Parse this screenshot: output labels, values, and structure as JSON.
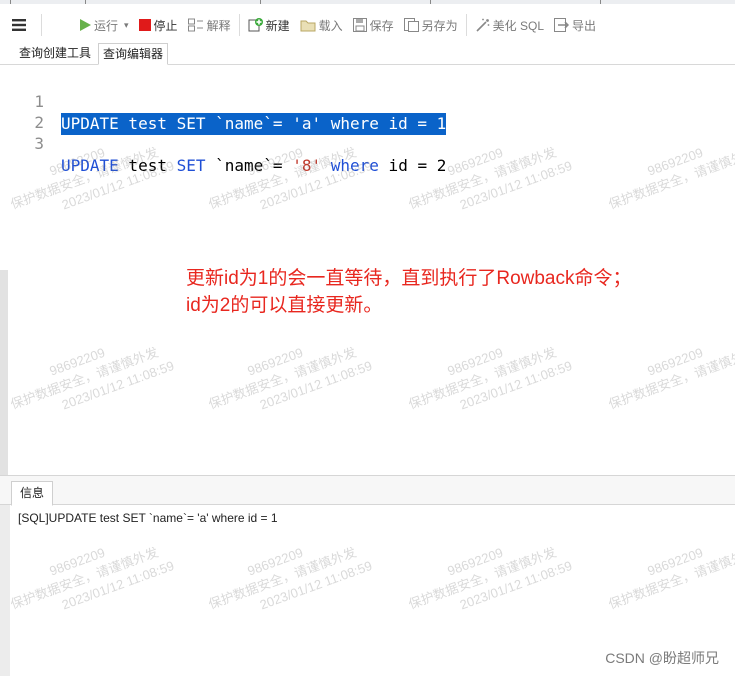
{
  "toolbar": {
    "run_label": "运行",
    "run_dropdown": "▾",
    "stop_label": "停止",
    "explain_label": "解释",
    "new_label": "新建",
    "load_label": "载入",
    "save_label": "保存",
    "saveas_label": "另存为",
    "beautify_label": "美化 SQL",
    "export_label": "导出"
  },
  "subtabs": [
    "查询创建工具",
    "查询编辑器"
  ],
  "editor": {
    "lines": [
      {
        "num": "1",
        "tokens": [
          "UPDATE test SET `name`= 'a' where id = 1"
        ]
      },
      {
        "num": "2",
        "tokens": []
      },
      {
        "num": "3",
        "tokens": [
          "UPDATE",
          " test ",
          "SET",
          " `name`= ",
          "'8'",
          " ",
          "where",
          " id = 2"
        ]
      }
    ]
  },
  "annotation": {
    "line1": "更新id为1的会一直等待，直到执行了Rowback命令；",
    "line2": "id为2的可以直接更新。"
  },
  "panel": {
    "tab_label": "信息",
    "message": "[SQL]UPDATE test SET `name`= 'a' where id = 1"
  },
  "watermark": {
    "line1": "98692209",
    "line2": "保护数据安全，请谨慎外发",
    "line3": "2023/01/12 11:08:59"
  },
  "credit": "CSDN @盼超师兄",
  "colors": {
    "selection": "#0a63c9",
    "keyword": "#1f4fd6",
    "string": "#c0392b",
    "annotation": "#e8271f"
  }
}
